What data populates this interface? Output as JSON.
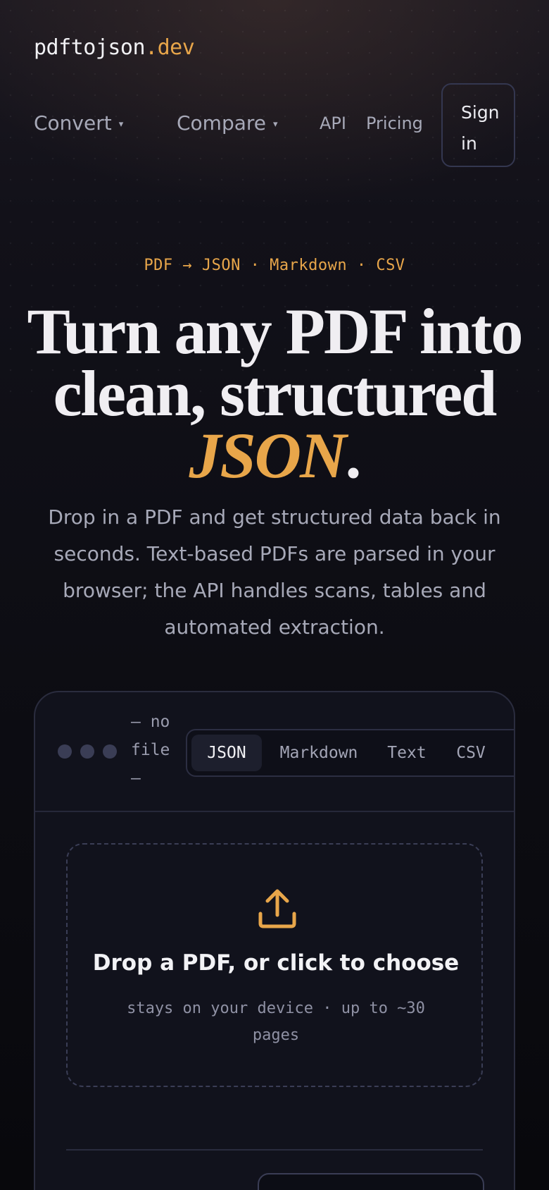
{
  "header": {
    "logo_main": "pdftojson",
    "logo_accent": ".dev",
    "nav": {
      "convert": "Convert",
      "compare": "Compare",
      "api": "API",
      "pricing": "Pricing",
      "caret": "▾"
    },
    "signin_line1": "Sign",
    "signin_line2": "in"
  },
  "hero": {
    "eyebrow": "PDF → JSON · Markdown · CSV",
    "headline_line1": "Turn any PDF into",
    "headline_line2": "clean, structured",
    "headline_highlight": "JSON",
    "headline_end": ".",
    "lede": "Drop in a PDF and get structured data back in seconds. Text-based PDFs are parsed in your browser; the API handles scans, tables and automated extraction."
  },
  "converter": {
    "file_status": "— no file —",
    "tabs": [
      "JSON",
      "Markdown",
      "Text",
      "CSV"
    ],
    "active_tab": "JSON",
    "dropzone_title": "Drop a PDF, or click to choose",
    "dropzone_sub": "stays on your device · up to ~30 pages",
    "icons": {
      "upload": "upload-icon"
    }
  },
  "colors": {
    "accent": "#e8a64a",
    "background": "#0c0c12",
    "text": "#ececf1",
    "muted": "#a7a9b8",
    "border": "#2a2c3e"
  }
}
